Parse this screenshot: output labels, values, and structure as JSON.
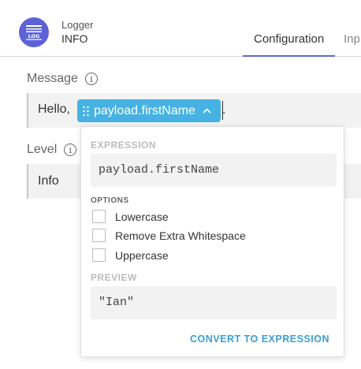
{
  "header": {
    "component_name": "Logger",
    "component_level": "INFO",
    "logo_icon": "log-icon",
    "tabs": [
      {
        "label": "Configuration",
        "active": true
      },
      {
        "label": "Inp",
        "active": false
      }
    ]
  },
  "message": {
    "label": "Message",
    "text_before": "Hello,",
    "pill_label": "payload.firstName",
    "text_after": "."
  },
  "level": {
    "label": "Level",
    "value": "Info"
  },
  "popover": {
    "expression_heading": "EXPRESSION",
    "expression_value": "payload.firstName",
    "options_heading": "OPTIONS",
    "options": [
      {
        "label": "Lowercase",
        "checked": false
      },
      {
        "label": "Remove Extra Whitespace",
        "checked": false
      },
      {
        "label": "Uppercase",
        "checked": false
      }
    ],
    "preview_heading": "PREVIEW",
    "preview_value": "\"Ian\"",
    "convert_label": "CONVERT TO EXPRESSION"
  },
  "colors": {
    "logo_bg": "#5c62d6",
    "pill_bg": "#45b2e3",
    "link": "#3a9fd6",
    "tab_underline": "#5a6cc7"
  }
}
